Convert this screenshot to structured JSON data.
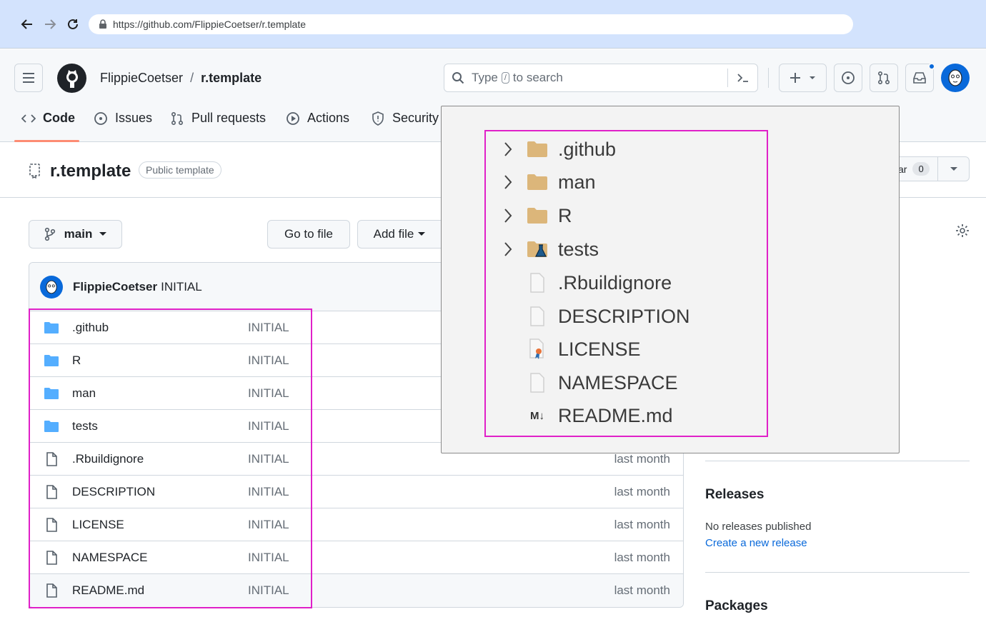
{
  "browser": {
    "url": "https://github.com/FlippieCoetser/r.template"
  },
  "header": {
    "owner": "FlippieCoetser",
    "separator": "/",
    "repo": "r.template",
    "search_prefix": "Type",
    "search_key": "/",
    "search_suffix": "to search"
  },
  "tabs": {
    "code": "Code",
    "issues": "Issues",
    "pull_requests": "Pull requests",
    "actions": "Actions",
    "security": "Security"
  },
  "repo": {
    "name": "r.template",
    "badge": "Public template",
    "star_label": "ar",
    "star_count": "0"
  },
  "toolbar": {
    "branch": "main",
    "go_to_file": "Go to file",
    "add_file": "Add file"
  },
  "commit": {
    "author": "FlippieCoetser",
    "message": "INITIAL"
  },
  "files": [
    {
      "name": ".github",
      "type": "folder",
      "message": "INITIAL",
      "date": ""
    },
    {
      "name": "R",
      "type": "folder",
      "message": "INITIAL",
      "date": ""
    },
    {
      "name": "man",
      "type": "folder",
      "message": "INITIAL",
      "date": ""
    },
    {
      "name": "tests",
      "type": "folder",
      "message": "INITIAL",
      "date": ""
    },
    {
      "name": ".Rbuildignore",
      "type": "file",
      "message": "INITIAL",
      "date": "last month"
    },
    {
      "name": "DESCRIPTION",
      "type": "file",
      "message": "INITIAL",
      "date": "last month"
    },
    {
      "name": "LICENSE",
      "type": "file",
      "message": "INITIAL",
      "date": "last month"
    },
    {
      "name": "NAMESPACE",
      "type": "file",
      "message": "INITIAL",
      "date": "last month"
    },
    {
      "name": "README.md",
      "type": "file",
      "message": "INITIAL",
      "date": "last month"
    }
  ],
  "sidebar": {
    "releases_title": "Releases",
    "no_releases": "No releases published",
    "create_release": "Create a new release",
    "packages_title": "Packages"
  },
  "explorer": {
    "items": [
      {
        "name": ".github",
        "kind": "folder",
        "icon": "folder-icon"
      },
      {
        "name": "man",
        "kind": "folder",
        "icon": "folder-icon"
      },
      {
        "name": "R",
        "kind": "folder",
        "icon": "folder-icon"
      },
      {
        "name": "tests",
        "kind": "folder",
        "icon": "test-folder-icon"
      },
      {
        "name": ".Rbuildignore",
        "kind": "file",
        "icon": "file-icon"
      },
      {
        "name": "DESCRIPTION",
        "kind": "file",
        "icon": "file-icon"
      },
      {
        "name": "LICENSE",
        "kind": "file",
        "icon": "license-icon"
      },
      {
        "name": "NAMESPACE",
        "kind": "file",
        "icon": "file-icon"
      },
      {
        "name": "README.md",
        "kind": "file",
        "icon": "markdown-icon",
        "icon_text": "M↓"
      }
    ]
  },
  "colors": {
    "highlight": "#e020c8",
    "folder_blue": "#54aeff",
    "link": "#0969da",
    "tab_underline": "#fd8c73"
  }
}
